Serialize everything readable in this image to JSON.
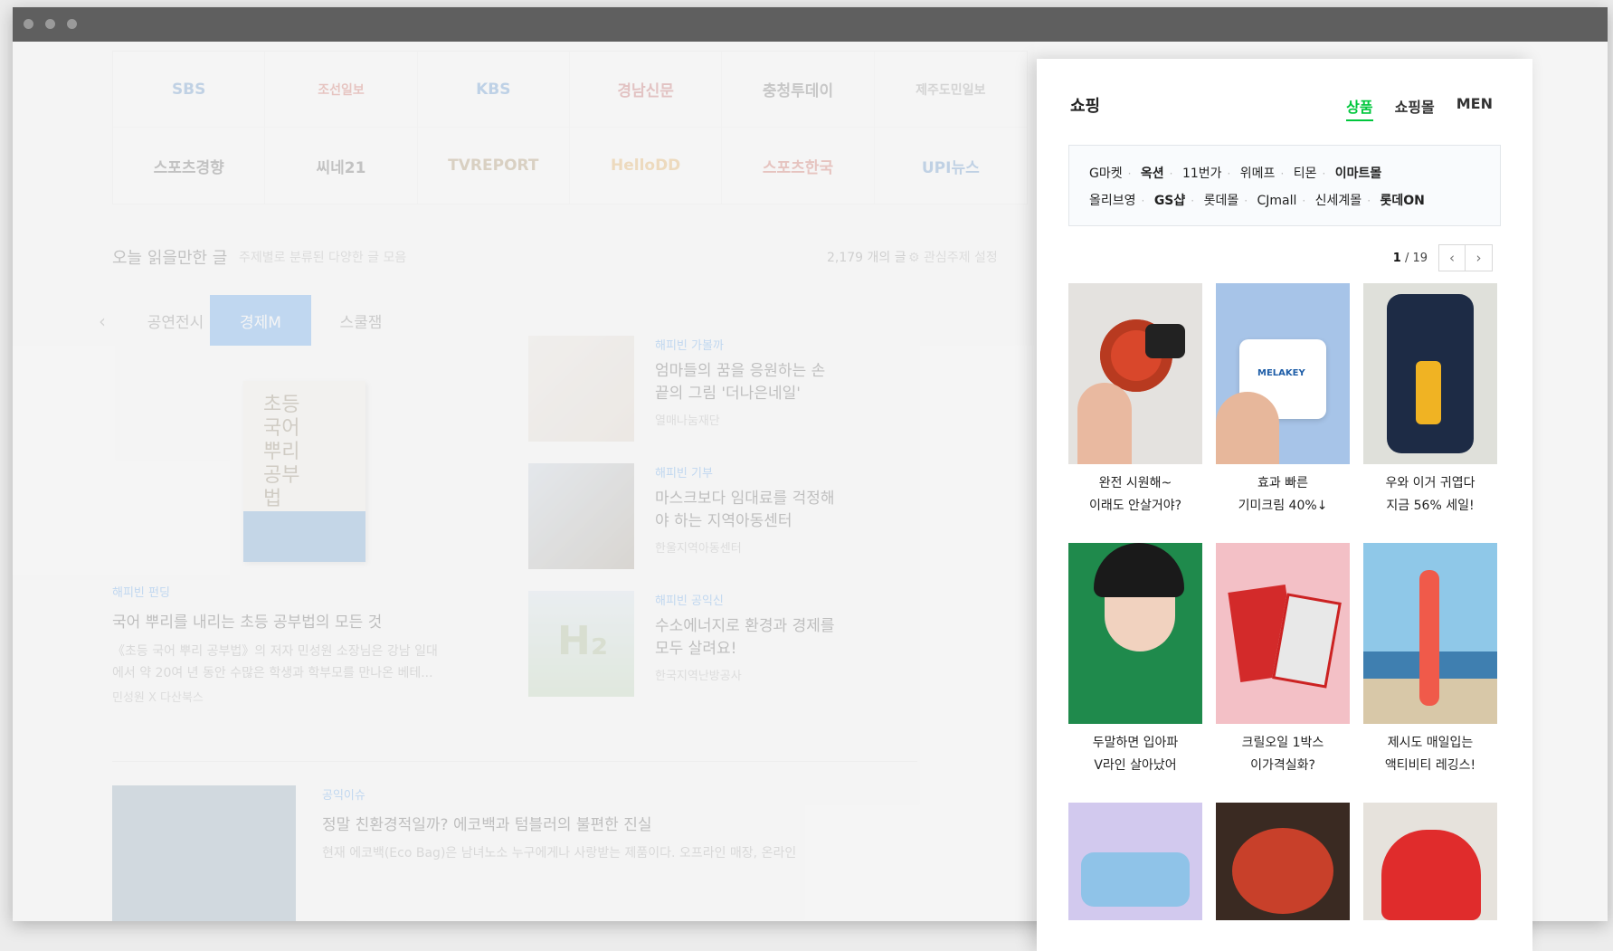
{
  "press": [
    "SBS",
    "조선일보",
    "KBS",
    "경남신문",
    "충청투데이",
    "제주도민일보",
    "스포츠경향",
    "씨네21",
    "TVREPORT",
    "HelloDD",
    "스포츠한국",
    "UPI뉴스"
  ],
  "section": {
    "title": "오늘 읽을만한 글",
    "subtitle": "주제별로 분류된 다양한 글 모음",
    "count": "2,179 개의 글",
    "setting": "관심주제 설정"
  },
  "category_tabs": {
    "items": [
      "공연전시",
      "경제M",
      "스쿨잼"
    ],
    "active": 1
  },
  "feature": {
    "category": "해피빈 펀딩",
    "title": "국어 뿌리를 내리는 초등 공부법의 모든 것",
    "desc1": "《초등 국어 뿌리 공부법》의 저자 민성원 소장님은 강남 일대",
    "desc2": "에서 약 20여 년 동안 수많은 학생과 학부모를 만나온 베테...",
    "source": "민성원 X 다산북스",
    "book_text": "초등 국어 뿌리 공부법"
  },
  "articles": [
    {
      "category": "해피빈 가볼까",
      "title": "엄마들의 꿈을 응원하는 손끝의 그림 '더나은네일'",
      "source": "열매나눔재단"
    },
    {
      "category": "해피빈 기부",
      "title": "마스크보다 임대료를 걱정해야 하는 지역아동센터",
      "source": "한울지역아동센터"
    },
    {
      "category": "해피빈 공익신",
      "title": "수소에너지로 환경과 경제를 모두 살려요!",
      "source": "한국지역난방공사"
    }
  ],
  "bottom_article": {
    "category": "공익이슈",
    "title": "정말 친환경적일까? 에코백과 텀블러의 불편한 진실",
    "desc": "현재 에코백(Eco Bag)은 남녀노소 누구에게나 사랑받는 제품이다. 오프라인 매장, 온라인"
  },
  "shopping": {
    "title": "쇼핑",
    "tabs": [
      "상품",
      "쇼핑몰",
      "MEN"
    ],
    "active_tab": 0,
    "malls_row1": [
      {
        "name": "G마켓",
        "strong": false
      },
      {
        "name": "옥션",
        "strong": true
      },
      {
        "name": "11번가",
        "strong": false
      },
      {
        "name": "위메프",
        "strong": false
      },
      {
        "name": "티몬",
        "strong": false
      },
      {
        "name": "이마트몰",
        "strong": true
      }
    ],
    "malls_row2": [
      {
        "name": "올리브영",
        "strong": false
      },
      {
        "name": "GS샵",
        "strong": true
      },
      {
        "name": "롯데몰",
        "strong": false
      },
      {
        "name": "CJmall",
        "strong": false
      },
      {
        "name": "신세계몰",
        "strong": false
      },
      {
        "name": "롯데ON",
        "strong": true
      }
    ],
    "page_current": "1",
    "page_total": "/ 19",
    "products": [
      {
        "line1": "완전 시원해~",
        "line2": "이래도 안살거야?"
      },
      {
        "line1": "효과 빠른",
        "line2": "기미크림 40%↓"
      },
      {
        "line1": "우와 이거 귀엽다",
        "line2": "지금 56% 세일!"
      },
      {
        "line1": "두말하면 입아파",
        "line2": "V라인 살아났어"
      },
      {
        "line1": "크릴오일 1박스",
        "line2": "이가격실화?"
      },
      {
        "line1": "제시도 매일입는",
        "line2": "액티비티 레깅스!"
      }
    ],
    "product_text": {
      "cream_label": "MELAKEY",
      "case_label": ""
    }
  },
  "colors": {
    "accent_green": "#00c73c",
    "link_blue": "#2b86e8",
    "titlebar": "#5f5f5f"
  }
}
